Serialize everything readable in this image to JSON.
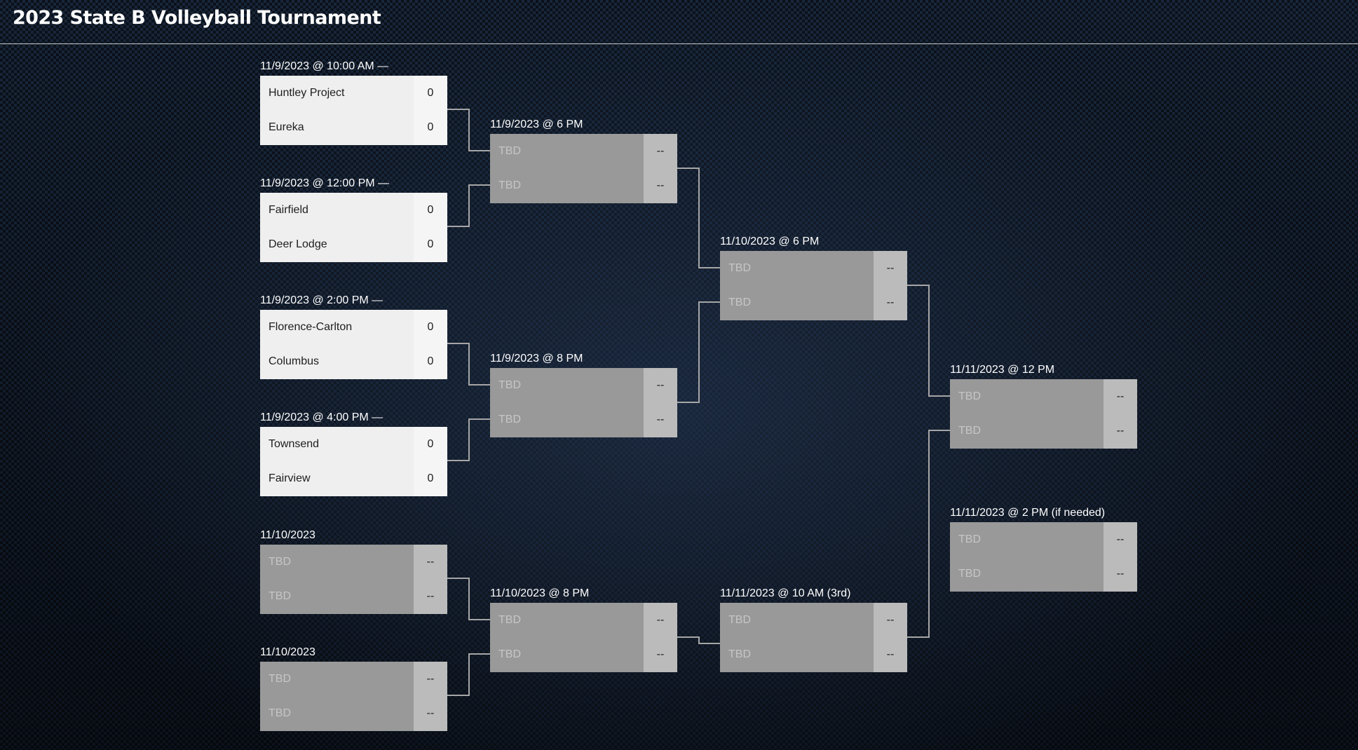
{
  "header": {
    "title": "2023 State B Volleyball Tournament"
  },
  "colors": {
    "connector": "#a6a6a6",
    "played_bg": "#efefef",
    "pending_bg": "#999999",
    "pending_score_bg": "#bbbbbb"
  },
  "matches": [
    {
      "label": "11/9/2023 @ 10:00 AM —",
      "status": "played",
      "teams": [
        {
          "name": "Huntley Project",
          "score": "0"
        },
        {
          "name": "Eureka",
          "score": "0"
        }
      ]
    },
    {
      "label": "11/9/2023 @ 12:00 PM —",
      "status": "played",
      "teams": [
        {
          "name": "Fairfield",
          "score": "0"
        },
        {
          "name": "Deer Lodge",
          "score": "0"
        }
      ]
    },
    {
      "label": "11/9/2023 @ 2:00 PM —",
      "status": "played",
      "teams": [
        {
          "name": "Florence-Carlton",
          "score": "0"
        },
        {
          "name": "Columbus",
          "score": "0"
        }
      ]
    },
    {
      "label": "11/9/2023 @ 4:00 PM —",
      "status": "played",
      "teams": [
        {
          "name": "Townsend",
          "score": "0"
        },
        {
          "name": "Fairview",
          "score": "0"
        }
      ]
    },
    {
      "label": "11/10/2023",
      "status": "pending",
      "teams": [
        {
          "name": "TBD",
          "score": "--"
        },
        {
          "name": "TBD",
          "score": "--"
        }
      ]
    },
    {
      "label": "11/10/2023",
      "status": "pending",
      "teams": [
        {
          "name": "TBD",
          "score": "--"
        },
        {
          "name": "TBD",
          "score": "--"
        }
      ]
    },
    {
      "label": "11/9/2023 @ 6 PM",
      "status": "pending",
      "teams": [
        {
          "name": "TBD",
          "score": "--"
        },
        {
          "name": "TBD",
          "score": "--"
        }
      ]
    },
    {
      "label": "11/9/2023 @ 8 PM",
      "status": "pending",
      "teams": [
        {
          "name": "TBD",
          "score": "--"
        },
        {
          "name": "TBD",
          "score": "--"
        }
      ]
    },
    {
      "label": "11/10/2023 @ 8 PM",
      "status": "pending",
      "teams": [
        {
          "name": "TBD",
          "score": "--"
        },
        {
          "name": "TBD",
          "score": "--"
        }
      ]
    },
    {
      "label": "11/10/2023 @ 6 PM",
      "status": "pending",
      "teams": [
        {
          "name": "TBD",
          "score": "--"
        },
        {
          "name": "TBD",
          "score": "--"
        }
      ]
    },
    {
      "label": "11/11/2023 @ 10 AM (3rd)",
      "status": "pending",
      "teams": [
        {
          "name": "TBD",
          "score": "--"
        },
        {
          "name": "TBD",
          "score": "--"
        }
      ]
    },
    {
      "label": "11/11/2023 @ 12 PM",
      "status": "pending",
      "teams": [
        {
          "name": "TBD",
          "score": "--"
        },
        {
          "name": "TBD",
          "score": "--"
        }
      ]
    },
    {
      "label": "11/11/2023 @ 2 PM (if needed)",
      "status": "pending",
      "teams": [
        {
          "name": "TBD",
          "score": "--"
        },
        {
          "name": "TBD",
          "score": "--"
        }
      ]
    }
  ]
}
